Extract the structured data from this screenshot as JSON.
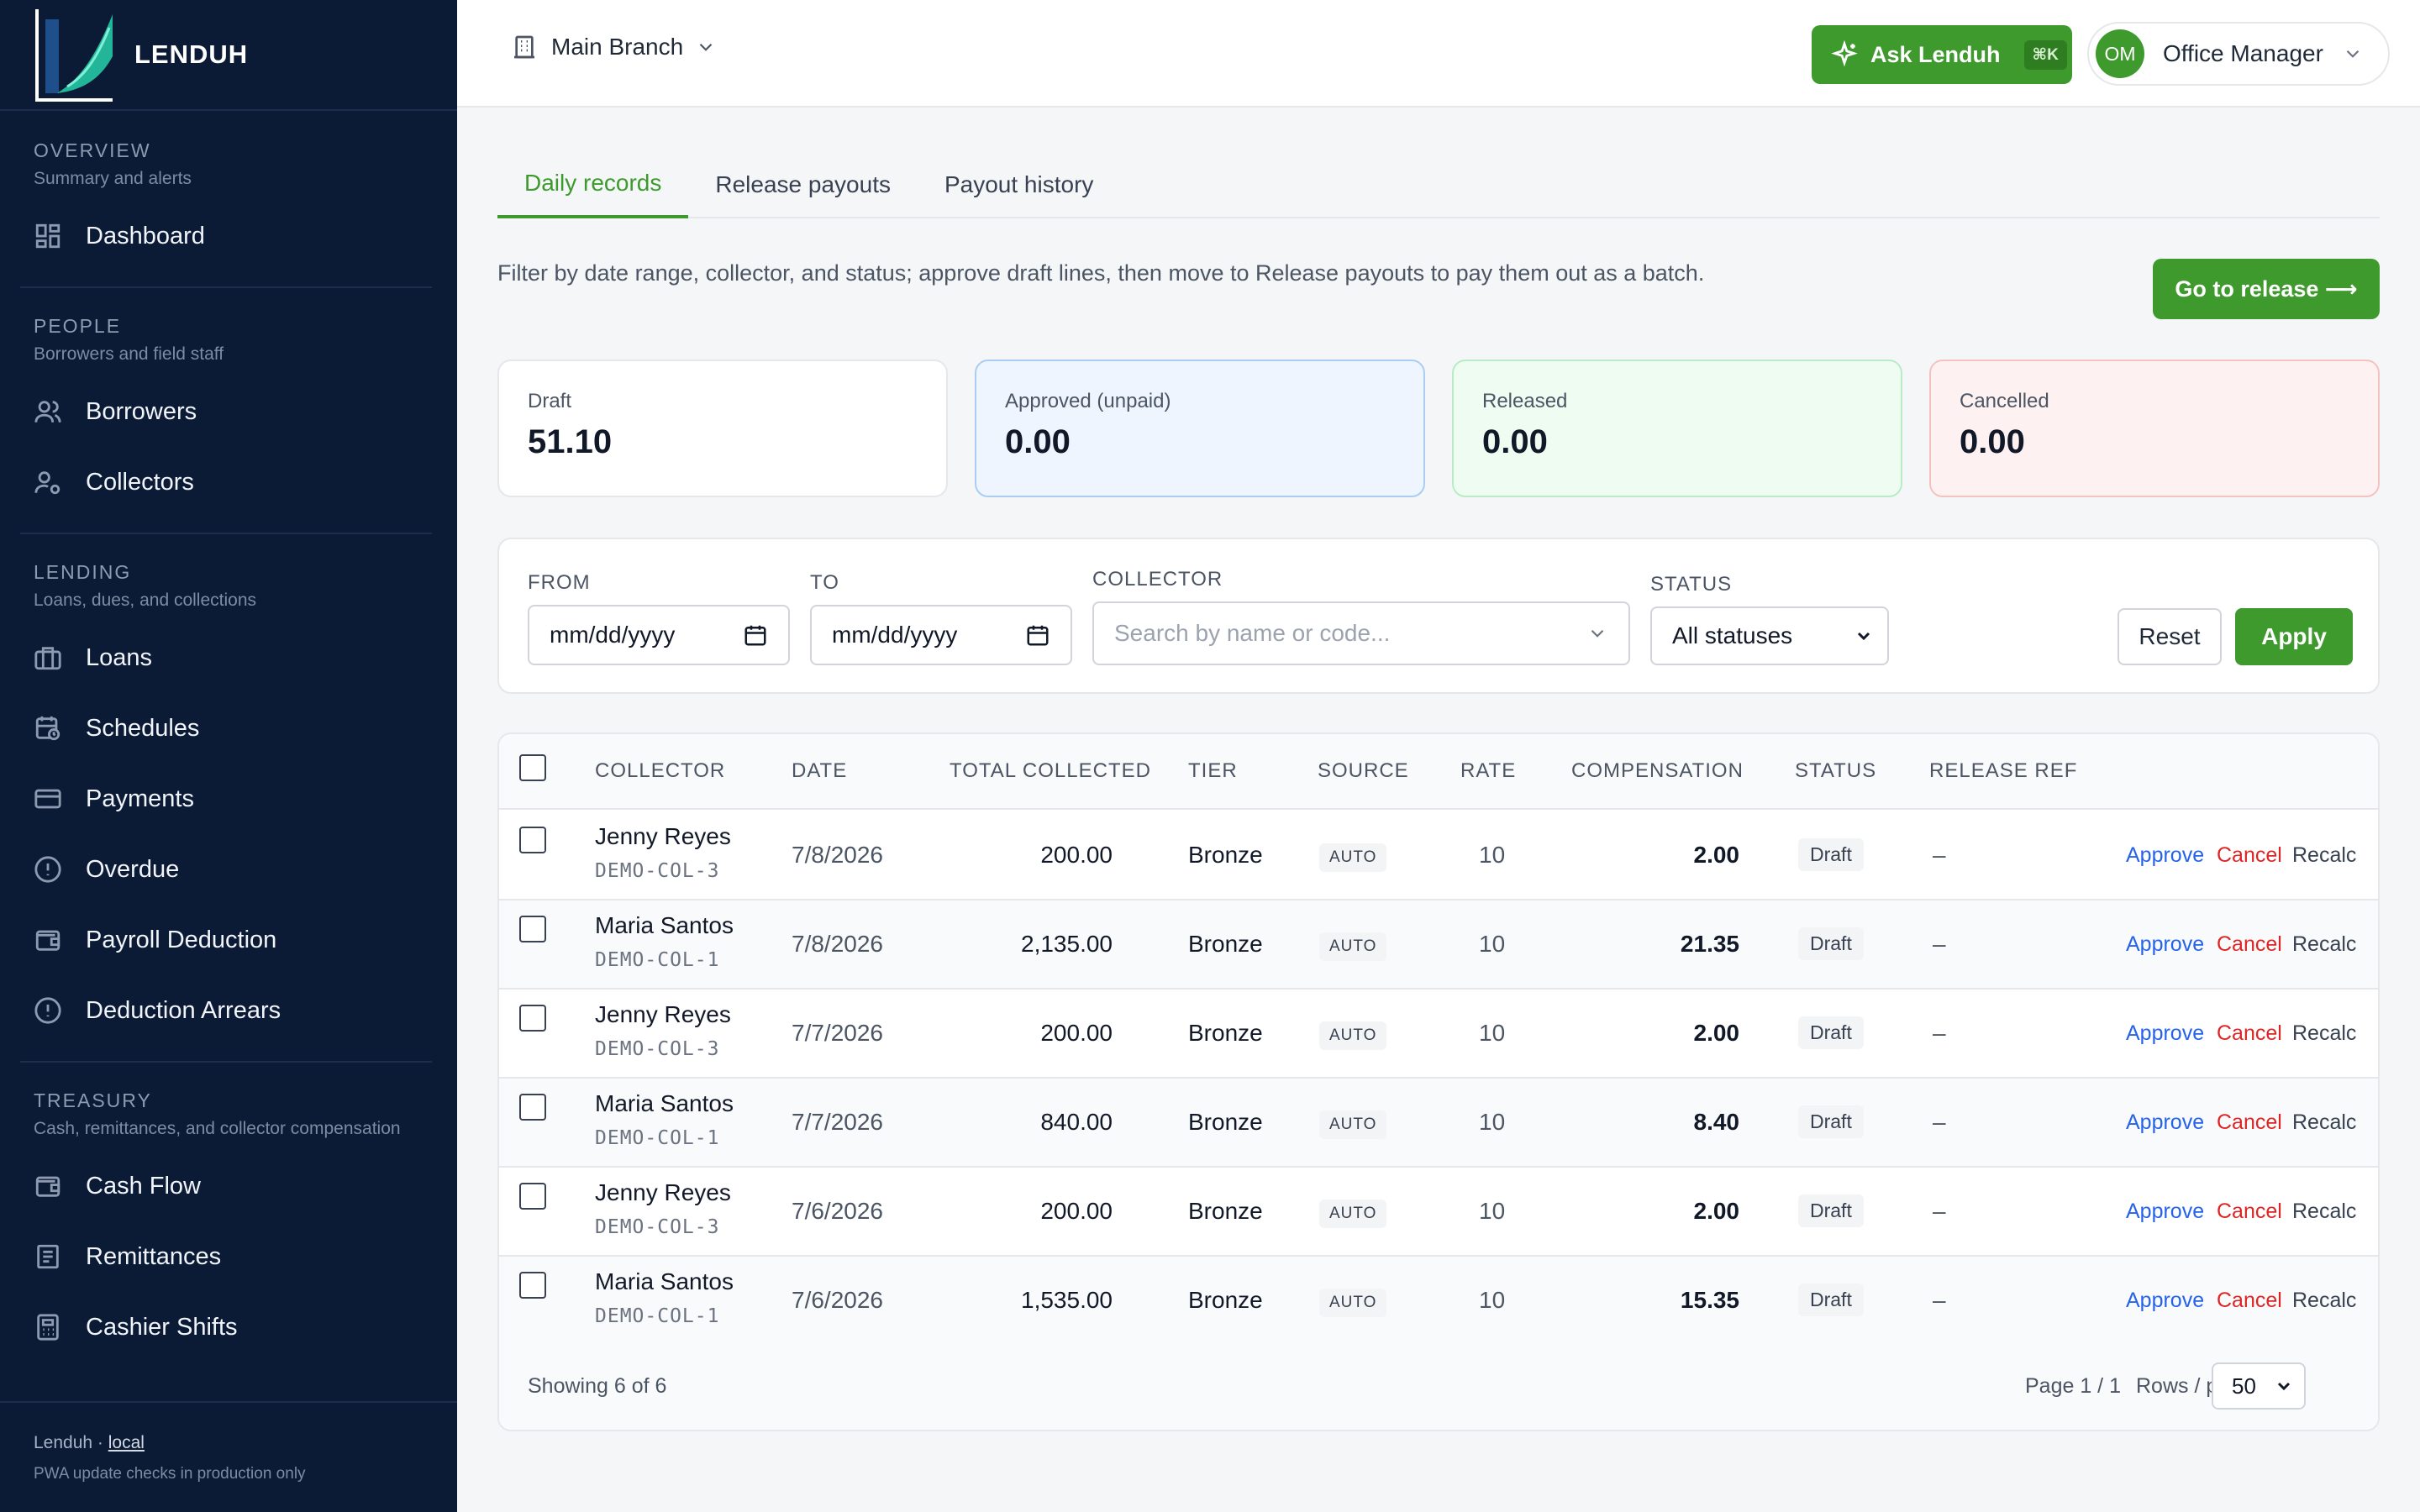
{
  "brand": {
    "name": "LENDUH"
  },
  "sidebar": {
    "sections": [
      {
        "title": "OVERVIEW",
        "subtitle": "Summary and alerts",
        "items": [
          {
            "label": "Dashboard",
            "icon": "grid-icon"
          }
        ]
      },
      {
        "title": "PEOPLE",
        "subtitle": "Borrowers and field staff",
        "items": [
          {
            "label": "Borrowers",
            "icon": "users-icon"
          },
          {
            "label": "Collectors",
            "icon": "user-cog-icon"
          }
        ]
      },
      {
        "title": "LENDING",
        "subtitle": "Loans, dues, and collections",
        "items": [
          {
            "label": "Loans",
            "icon": "briefcase-icon"
          },
          {
            "label": "Schedules",
            "icon": "calendar-clock-icon"
          },
          {
            "label": "Payments",
            "icon": "credit-card-icon"
          },
          {
            "label": "Overdue",
            "icon": "alert-circle-icon"
          },
          {
            "label": "Payroll Deduction",
            "icon": "wallet-icon"
          },
          {
            "label": "Deduction Arrears",
            "icon": "alert-circle-icon"
          }
        ]
      },
      {
        "title": "TREASURY",
        "subtitle": "Cash, remittances, and collector compensation",
        "items": [
          {
            "label": "Cash Flow",
            "icon": "wallet-icon"
          },
          {
            "label": "Remittances",
            "icon": "receipt-icon"
          },
          {
            "label": "Cashier Shifts",
            "icon": "calculator-icon"
          }
        ]
      }
    ],
    "footer": {
      "app": "Lenduh ·",
      "env": "local",
      "note": "PWA update checks in production only"
    }
  },
  "topbar": {
    "branch": "Main Branch",
    "ask_label": "Ask Lenduh",
    "ask_shortcut": "⌘K",
    "user_initials": "OM",
    "user_role": "Office Manager"
  },
  "tabs": [
    {
      "label": "Daily records",
      "active": true
    },
    {
      "label": "Release payouts",
      "active": false
    },
    {
      "label": "Payout history",
      "active": false
    }
  ],
  "description": "Filter by date range, collector, and status; approve draft lines, then move to Release payouts to pay them out as a batch.",
  "go_release_label": "Go to release ⟶",
  "summary": [
    {
      "label": "Draft",
      "value": "51.10"
    },
    {
      "label": "Approved (unpaid)",
      "value": "0.00"
    },
    {
      "label": "Released",
      "value": "0.00"
    },
    {
      "label": "Cancelled",
      "value": "0.00"
    }
  ],
  "filters": {
    "from_label": "FROM",
    "from_value": "mm/dd/yyyy",
    "to_label": "TO",
    "to_value": "mm/dd/yyyy",
    "collector_label": "COLLECTOR",
    "collector_placeholder": "Search by name or code...",
    "status_label": "STATUS",
    "status_value": "All statuses",
    "reset_label": "Reset",
    "apply_label": "Apply"
  },
  "table": {
    "columns": [
      "COLLECTOR",
      "DATE",
      "TOTAL COLLECTED",
      "TIER",
      "SOURCE",
      "RATE",
      "COMPENSATION",
      "STATUS",
      "RELEASE REF"
    ],
    "rows": [
      {
        "name": "Jenny Reyes",
        "code": "DEMO-COL-3",
        "date": "7/8/2026",
        "total": "200.00",
        "tier": "Bronze",
        "source": "AUTO",
        "rate": "10",
        "comp": "2.00",
        "status": "Draft",
        "ref": "–"
      },
      {
        "name": "Maria Santos",
        "code": "DEMO-COL-1",
        "date": "7/8/2026",
        "total": "2,135.00",
        "tier": "Bronze",
        "source": "AUTO",
        "rate": "10",
        "comp": "21.35",
        "status": "Draft",
        "ref": "–"
      },
      {
        "name": "Jenny Reyes",
        "code": "DEMO-COL-3",
        "date": "7/7/2026",
        "total": "200.00",
        "tier": "Bronze",
        "source": "AUTO",
        "rate": "10",
        "comp": "2.00",
        "status": "Draft",
        "ref": "–"
      },
      {
        "name": "Maria Santos",
        "code": "DEMO-COL-1",
        "date": "7/7/2026",
        "total": "840.00",
        "tier": "Bronze",
        "source": "AUTO",
        "rate": "10",
        "comp": "8.40",
        "status": "Draft",
        "ref": "–"
      },
      {
        "name": "Jenny Reyes",
        "code": "DEMO-COL-3",
        "date": "7/6/2026",
        "total": "200.00",
        "tier": "Bronze",
        "source": "AUTO",
        "rate": "10",
        "comp": "2.00",
        "status": "Draft",
        "ref": "–"
      },
      {
        "name": "Maria Santos",
        "code": "DEMO-COL-1",
        "date": "7/6/2026",
        "total": "1,535.00",
        "tier": "Bronze",
        "source": "AUTO",
        "rate": "10",
        "comp": "15.35",
        "status": "Draft",
        "ref": "–"
      }
    ],
    "actions": {
      "approve": "Approve",
      "cancel": "Cancel",
      "recalc": "Recalc"
    },
    "footer": {
      "showing": "Showing 6 of 6",
      "page": "Page 1 / 1",
      "rows_label": "Rows / page",
      "rows_value": "50"
    }
  },
  "colors": {
    "sidebar_bg": "#0b1b36",
    "accent": "#3e9a2d",
    "approve": "#2563eb",
    "cancel": "#dc2626"
  }
}
